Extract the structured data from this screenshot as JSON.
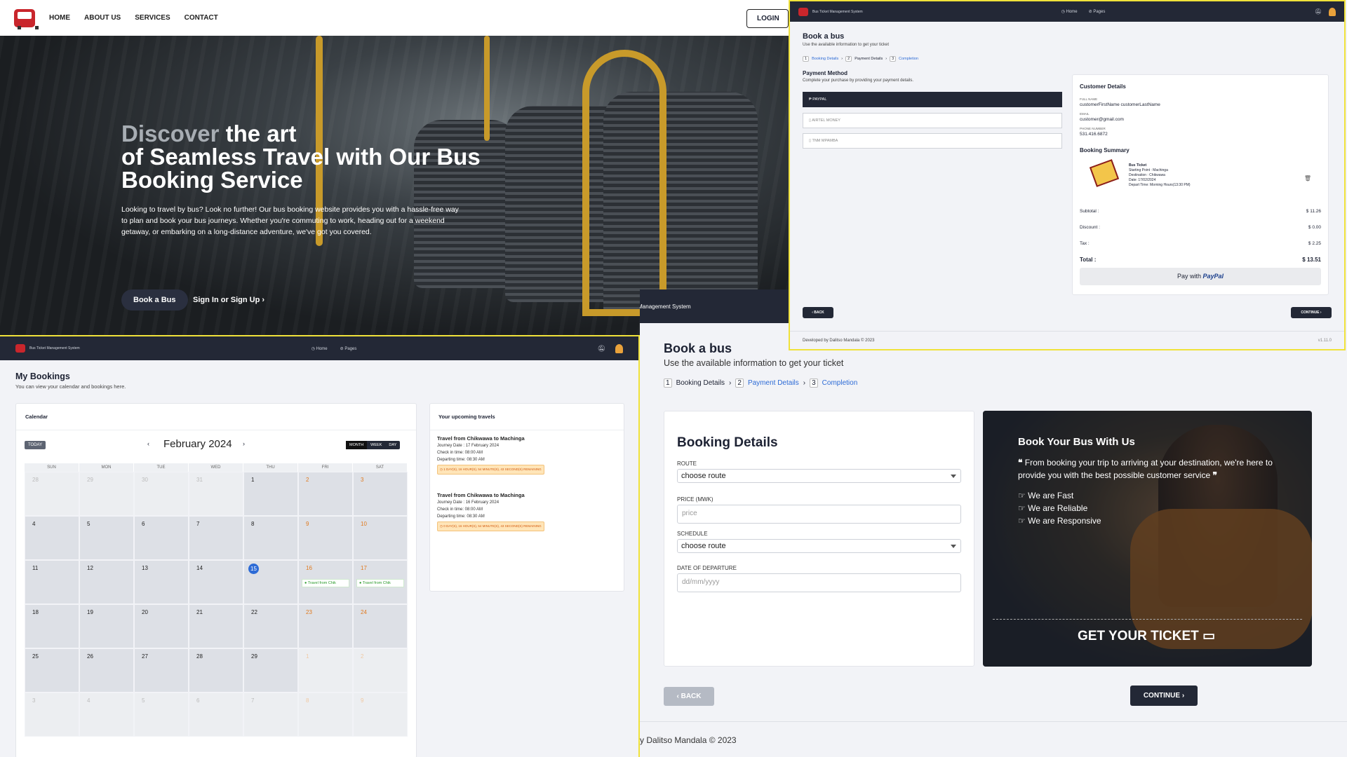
{
  "landing": {
    "nav": [
      "HOME",
      "ABOUT US",
      "SERVICES",
      "CONTACT"
    ],
    "login": "LOGIN",
    "title_dim": "Discover",
    "title_rest1": " the art",
    "title_line2": "of Seamless Travel with Our Bus",
    "title_line3": "Booking Service",
    "text": "Looking to travel by bus? Look no further! Our bus booking website provides you with a hassle-free way to plan and book your bus journeys. Whether you're commuting to work, heading out for a weekend getaway, or embarking on a long-distance adventure, we've got you covered.",
    "book_btn": "Book a Bus",
    "sign_btn": "Sign In or Sign Up"
  },
  "app_name": "Bus Ticket Management System",
  "appnav_links": [
    "Home",
    "Pages"
  ],
  "payment": {
    "title": "Book a bus",
    "subtitle": "Use the available information to get your ticket",
    "steps": [
      "Booking Details",
      "Payment Details",
      "Completion"
    ],
    "section": "Payment Method",
    "section_sub": "Complete your purchase by providing your payment details.",
    "methods": [
      "PAYPAL",
      "AIRTEL MONEY",
      "TNM MPAMBA"
    ],
    "customer_title": "Customer Details",
    "full_name_label": "FULL NAME",
    "full_name": "customerFirstName customerLastName",
    "email_label": "EMAIL",
    "email": "customer@gmail.com",
    "phone_label": "PHONE NUMBER",
    "phone": "531.416.6872",
    "summary_title": "Booking Summary",
    "ticket_name": "Bus Ticket",
    "ticket_lines": [
      "Starting Point : Machinga",
      "Destination : Chikwawa",
      "Date: 17/02/2024",
      "Depart Time: Morning Hours(13:30 PM)"
    ],
    "subtotal_label": "Subtotal :",
    "subtotal": "$ 11.26",
    "discount_label": "Discount :",
    "discount": "$ 0.00",
    "tax_label": "Tax :",
    "tax": "$ 2.25",
    "total_label": "Total :",
    "total": "$ 13.51",
    "paypal_pre": "Pay with",
    "paypal": "PayPal",
    "back": "BACK",
    "continue": "CONTINUE",
    "footer": "Developed by Dalitso Mandala © 2023",
    "version": "v1.11.0"
  },
  "bookings": {
    "title": "My Bookings",
    "subtitle": "You can view your calendar and bookings here.",
    "calendar_title": "Calendar",
    "today": "TODAY",
    "month": "February 2024",
    "views": [
      "MONTH",
      "WEEK",
      "DAY"
    ],
    "weekdays": [
      "SUN",
      "MON",
      "TUE",
      "WED",
      "THU",
      "FRI",
      "SAT"
    ],
    "event_label": "Travel from Chik",
    "upcoming_title": "Your upcoming travels",
    "travels": [
      {
        "title": "Travel from Chikwawa to Machinga",
        "date": "Journey Date : 17 February 2024",
        "checkin": "Check in time: 08:00 AM",
        "depart": "Departing time: 08:30 AM",
        "remain": "1 DAY(S), 16 HOUR(S), 54 MINUTE(S), 43 SECOND(S) REMAINING"
      },
      {
        "title": "Travel from Chikwawa to Machinga",
        "date": "Journey Date : 16 February 2024",
        "checkin": "Check in time: 08:00 AM",
        "depart": "Departing time: 08:30 AM",
        "remain": "0 DAY(S), 16 HOUR(S), 54 MINUTE(S), 43 SECOND(S) REMAINING"
      }
    ]
  },
  "details": {
    "strip": "Bus Ticket Management System",
    "title": "Book a bus",
    "subtitle": "Use the available information to get your ticket",
    "steps": [
      "Booking Details",
      "Payment Details",
      "Completion"
    ],
    "form_title": "Booking Details",
    "route_label": "ROUTE",
    "route_value": "choose route",
    "price_label": "PRICE (MWK)",
    "price_placeholder": "price",
    "schedule_label": "SCHEDULE",
    "schedule_value": "choose route",
    "date_label": "DATE OF DEPARTURE",
    "date_placeholder": "dd/mm/yyyy",
    "promo_title": "Book Your Bus With Us",
    "promo_quote": "From booking your trip to arriving at your destination, we're here to provide you with the best possible customer service",
    "promo_points": [
      "We are Fast",
      "We are Reliable",
      "We are Responsive"
    ],
    "get_ticket": "GET YOUR TICKET",
    "back": "BACK",
    "continue": "CONTINUE",
    "footer": "y Dalitso Mandala © 2023"
  }
}
